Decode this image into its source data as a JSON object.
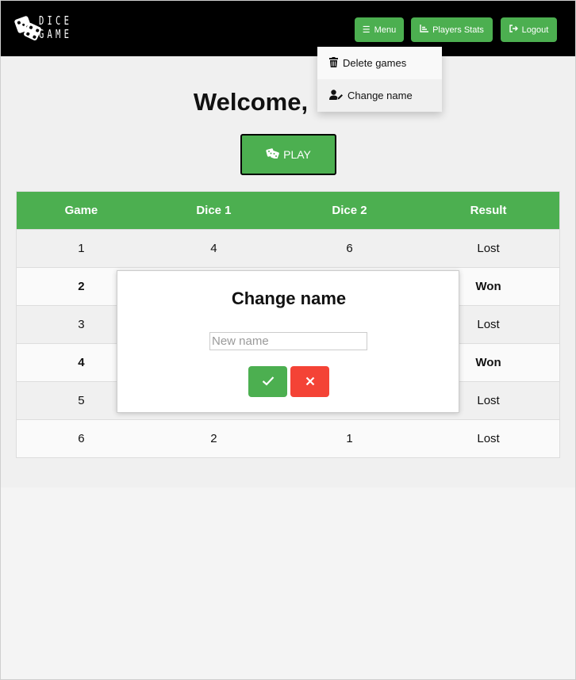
{
  "brand": {
    "logo_text_line1": "DICE",
    "logo_text_line2": "GAME"
  },
  "nav": {
    "menu_label": "Menu",
    "stats_label": "Players Stats",
    "logout_label": "Logout"
  },
  "dropdown": {
    "items": [
      {
        "label": "Delete games",
        "icon": "trash-icon"
      },
      {
        "label": "Change name",
        "icon": "user-edit-icon"
      }
    ]
  },
  "main": {
    "welcome": "Welcome,",
    "play_label": "PLAY"
  },
  "table": {
    "headers": [
      "Game",
      "Dice 1",
      "Dice 2",
      "Result"
    ],
    "rows": [
      {
        "game": "1",
        "dice1": "4",
        "dice2": "6",
        "result": "Lost"
      },
      {
        "game": "2",
        "dice1": "",
        "dice2": "",
        "result": "Won"
      },
      {
        "game": "3",
        "dice1": "",
        "dice2": "",
        "result": "Lost"
      },
      {
        "game": "4",
        "dice1": "",
        "dice2": "",
        "result": "Won"
      },
      {
        "game": "5",
        "dice1": "",
        "dice2": "",
        "result": "Lost"
      },
      {
        "game": "6",
        "dice1": "2",
        "dice2": "1",
        "result": "Lost"
      }
    ]
  },
  "modal": {
    "title": "Change name",
    "input_value": "",
    "input_placeholder": "New name"
  },
  "colors": {
    "accent": "#4caf50",
    "danger": "#f44336",
    "nav_bg": "#000000"
  }
}
